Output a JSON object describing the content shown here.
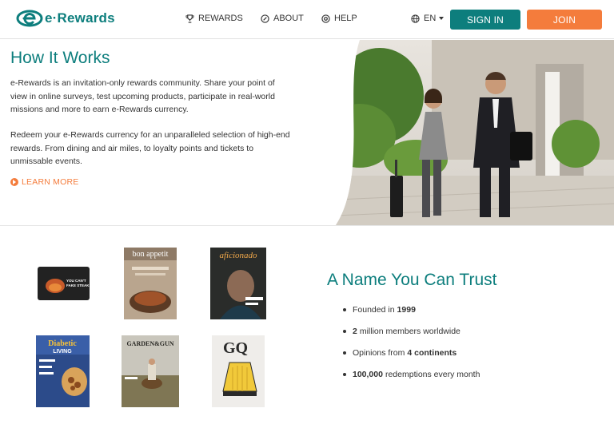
{
  "header": {
    "logo_text": "e·Rewards",
    "nav": {
      "rewards": "REWARDS",
      "about": "ABOUT",
      "help": "HELP",
      "language": "EN"
    },
    "sign_in": "SIGN IN",
    "join": "JOIN"
  },
  "hero": {
    "title": "How It Works",
    "paragraph1": "e-Rewards is an invitation-only rewards community. Share your point of view in online surveys, test upcoming products, participate in real-world missions and more to earn e-Rewards currency.",
    "paragraph2": "Redeem your e-Rewards currency for an unparalleled selection of high-end rewards. From dining and air miles, to loyalty points and tickets to unmissable events.",
    "learn_more": "LEARN MORE"
  },
  "rewards_gallery": {
    "items": [
      {
        "name": "Gift card",
        "cover_text": "YOU CAN'T FAKE STEAK"
      },
      {
        "name": "bon appétit",
        "cover_text": "bon appetit"
      },
      {
        "name": "Cigar Aficionado",
        "cover_text": "aficionado"
      },
      {
        "name": "Diabetic Living",
        "cover_text": "Diabetic LIVING"
      },
      {
        "name": "Garden & Gun",
        "cover_text": "GARDEN&GUN"
      },
      {
        "name": "GQ",
        "cover_text": "GQ"
      }
    ]
  },
  "trust": {
    "title": "A Name You Can Trust",
    "facts": [
      {
        "pre": "Founded in",
        "bold": "1999",
        "post": ""
      },
      {
        "pre": "",
        "bold": "2",
        "post": "million members worldwide"
      },
      {
        "pre": "Opinions from",
        "bold": "4 continents",
        "post": ""
      },
      {
        "pre": "",
        "bold": "100,000",
        "post": "redemptions every month"
      }
    ]
  },
  "colors": {
    "brand_teal": "#0d7e7d",
    "accent_orange": "#f47c3c"
  }
}
